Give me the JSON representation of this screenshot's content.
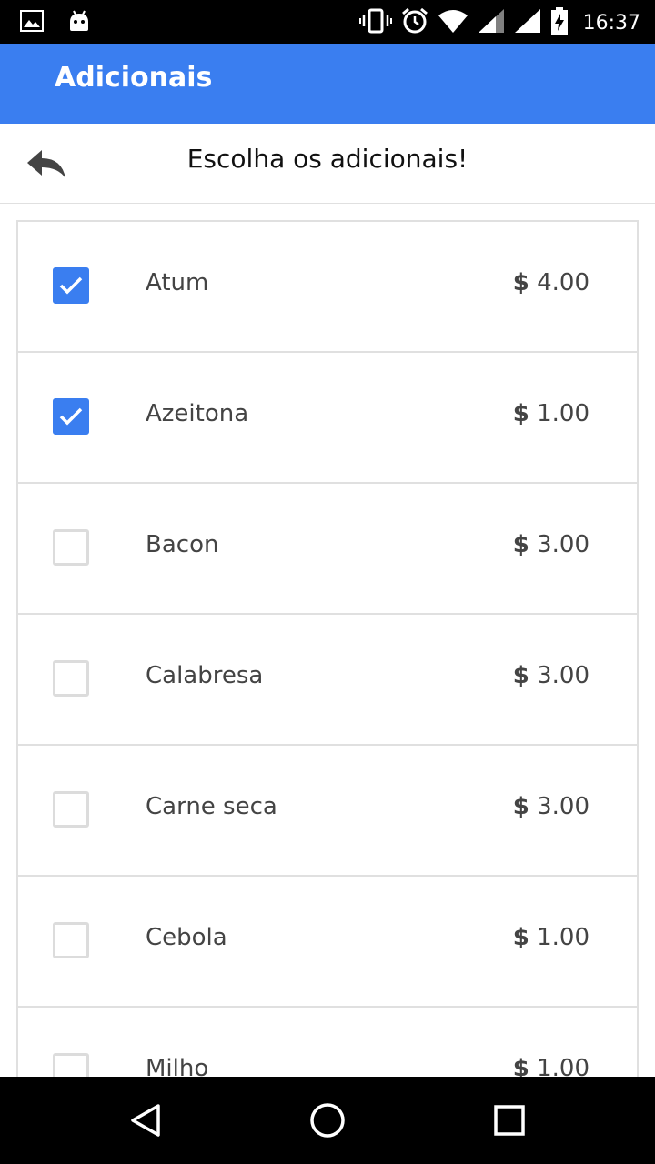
{
  "status_bar": {
    "time": "16:37",
    "icons": [
      "image-icon",
      "android-icon",
      "vibrate-icon",
      "alarm-icon",
      "wifi-icon",
      "signal-icon",
      "signal-icon",
      "battery-charging-icon"
    ]
  },
  "app_bar": {
    "title": "Adicionais"
  },
  "subheader": {
    "title": "Escolha os adicionais!",
    "back_icon": "reply-back-icon"
  },
  "accent_color": "#3a7ef0",
  "items": [
    {
      "name": "Atum",
      "currency": "$",
      "price": "4.00",
      "checked": true
    },
    {
      "name": "Azeitona",
      "currency": "$",
      "price": "1.00",
      "checked": true
    },
    {
      "name": "Bacon",
      "currency": "$",
      "price": "3.00",
      "checked": false
    },
    {
      "name": "Calabresa",
      "currency": "$",
      "price": "3.00",
      "checked": false
    },
    {
      "name": "Carne seca",
      "currency": "$",
      "price": "3.00",
      "checked": false
    },
    {
      "name": "Cebola",
      "currency": "$",
      "price": "1.00",
      "checked": false
    },
    {
      "name": "Milho",
      "currency": "$",
      "price": "1.00",
      "checked": false
    }
  ],
  "nav_bar": {
    "icons": [
      "back-triangle-icon",
      "home-circle-icon",
      "recents-square-icon"
    ]
  }
}
